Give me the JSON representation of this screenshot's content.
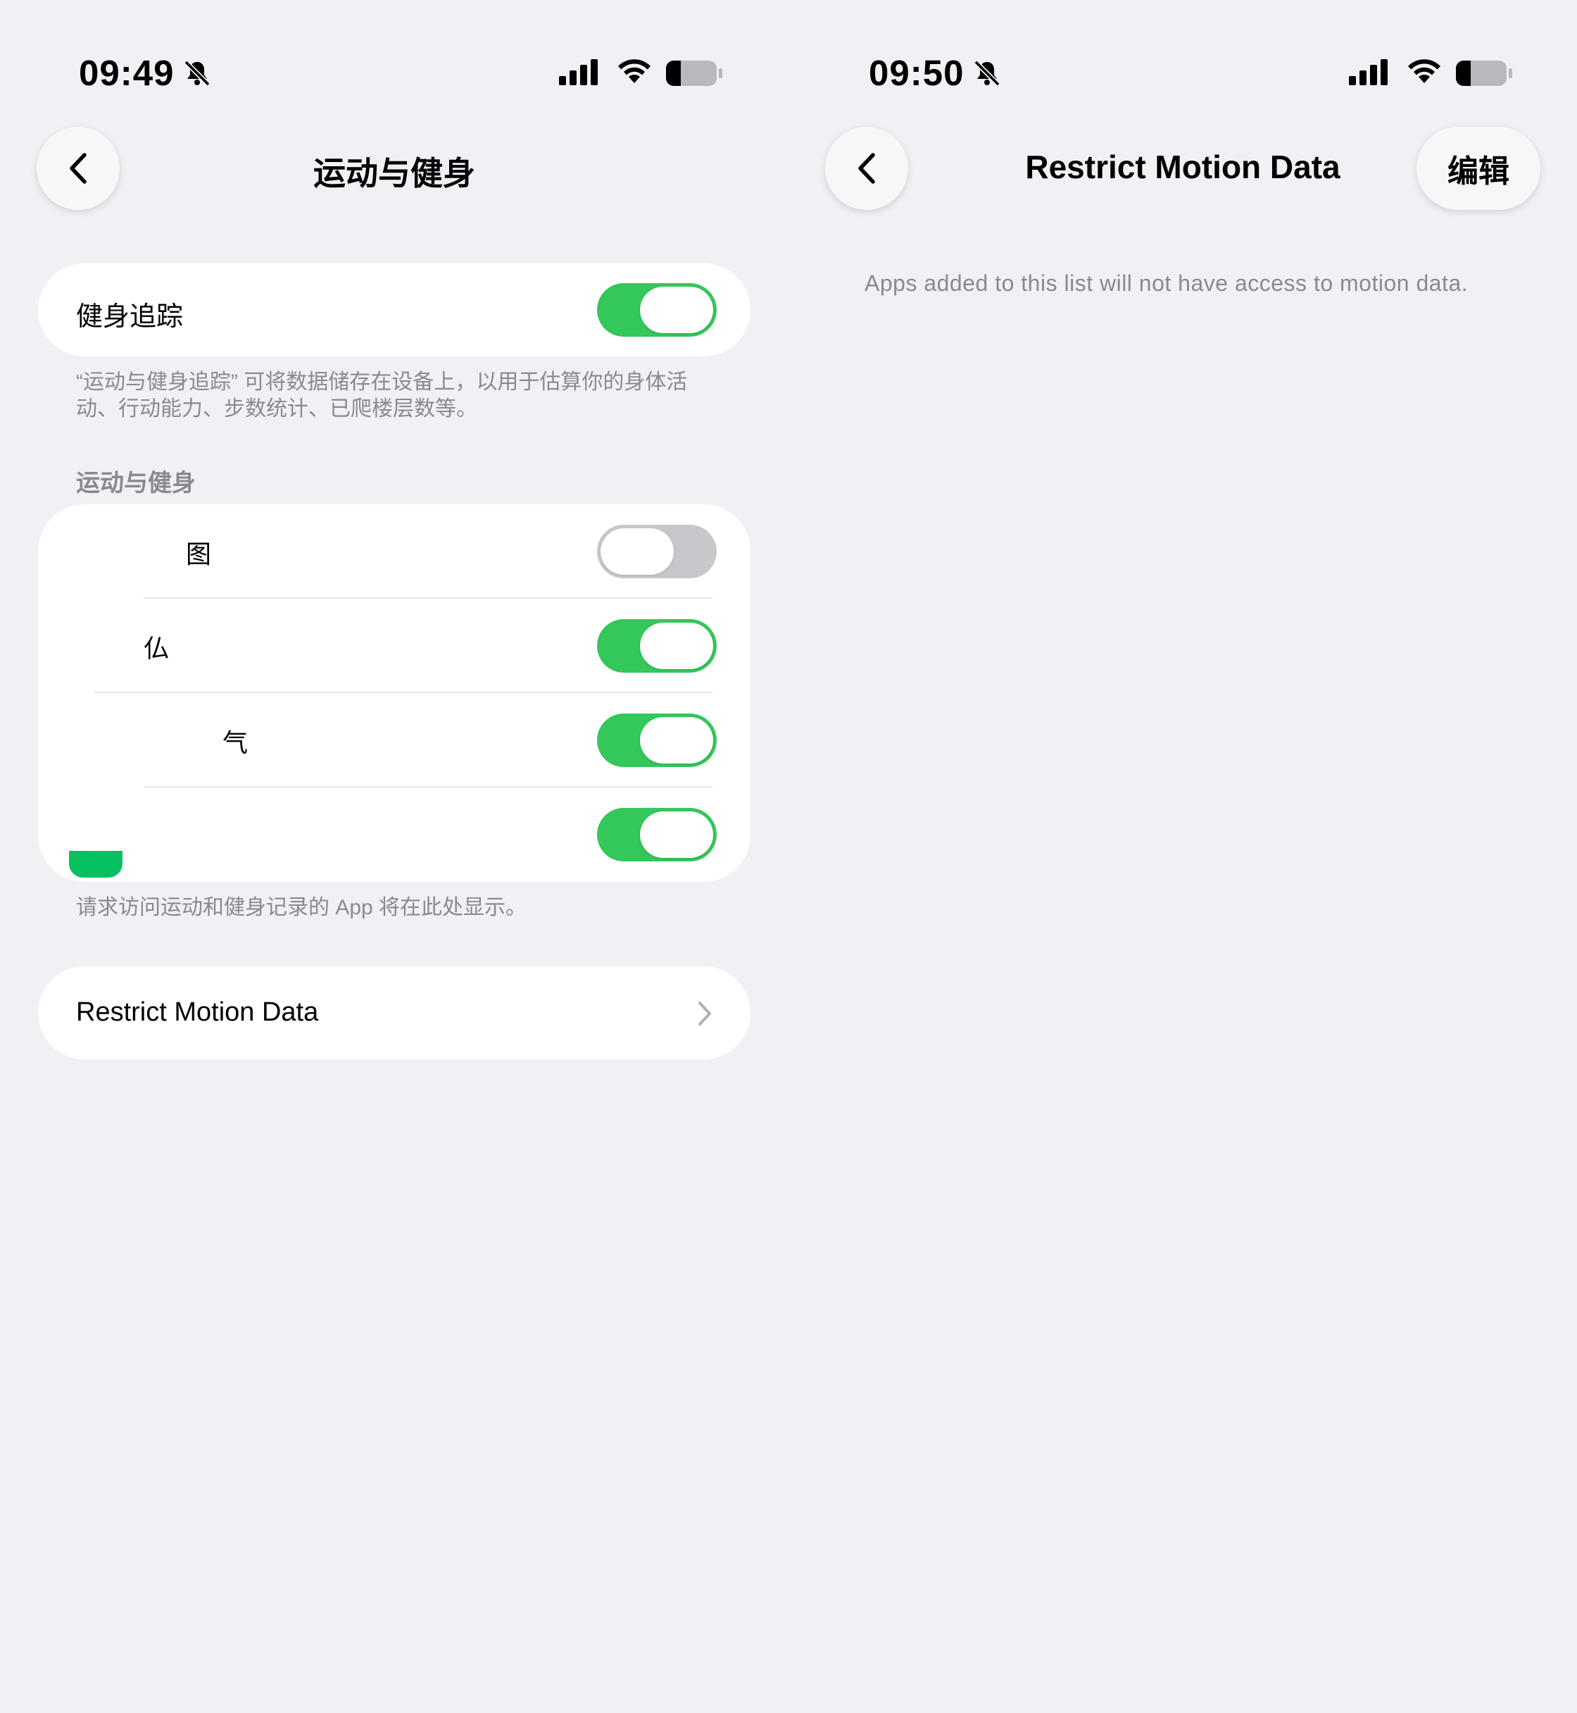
{
  "left": {
    "status": {
      "time": "09:49"
    },
    "nav": {
      "title": "运动与健身"
    },
    "fitness_tracking": {
      "label": "健身追踪",
      "enabled": true,
      "footnote": "“运动与健身追踪” 可将数据储存在设备上，以用于估算你的身体活动、行动能力、步数统计、已爬楼层数等。"
    },
    "section": {
      "header": "运动与健身",
      "apps": [
        {
          "name": "图",
          "enabled": false,
          "icon": "app-icon"
        },
        {
          "name": "仏",
          "enabled": true,
          "icon": "app-icon"
        },
        {
          "name": "气",
          "enabled": true,
          "icon": "app-icon"
        },
        {
          "name": "",
          "enabled": true,
          "icon": "app-icon"
        }
      ],
      "footnote": "请求访问运动和健身记录的 App 将在此处显示。"
    },
    "restrict_row": {
      "label": "Restrict Motion Data",
      "icon": "chevron-right-icon"
    }
  },
  "right": {
    "status": {
      "time": "09:50"
    },
    "nav": {
      "title": "Restrict Motion Data",
      "edit_label": "编辑"
    },
    "note": "Apps added to this list will not have access to motion data."
  },
  "colors": {
    "background": "#f1f1f5",
    "toggle_on": "#34c759",
    "toggle_off": "#c7c7cc",
    "secondary_text": "#8a8a8e"
  }
}
